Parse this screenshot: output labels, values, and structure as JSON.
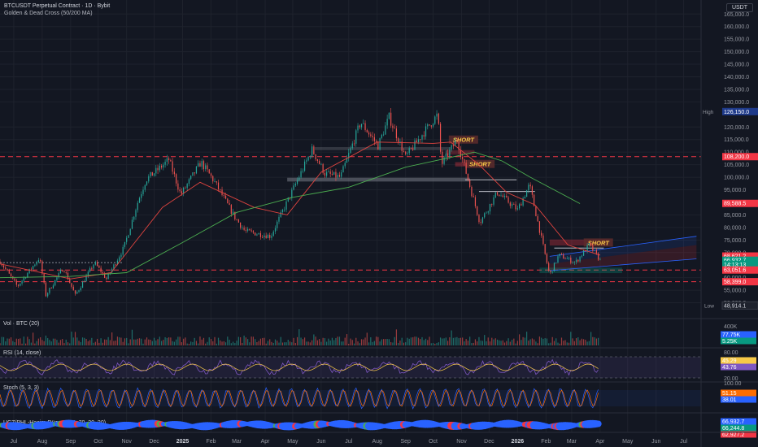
{
  "header": {
    "title": "BTCUSDT Perpetual Contract · 1D · Bybit",
    "indicator": "Golden & Dead Cross (50/200 MA)",
    "currency": "USDT"
  },
  "price_axis": {
    "ticks": [
      "165,000.0",
      "160,000.0",
      "155,000.0",
      "150,000.0",
      "145,000.0",
      "140,000.0",
      "135,000.0",
      "130,000.0",
      "120,000.0",
      "115,000.0",
      "110,000.0",
      "105,000.0",
      "100,000.0",
      "95,000.0",
      "85,000.0",
      "80,000.0",
      "75,000.0",
      "70,000.0",
      "60,000.0",
      "55,000.0",
      "50,000.0"
    ],
    "tick_values": [
      165000,
      160000,
      155000,
      150000,
      145000,
      140000,
      135000,
      130000,
      120000,
      115000,
      110000,
      105000,
      100000,
      95000,
      85000,
      80000,
      75000,
      70000,
      60000,
      55000,
      50000
    ],
    "high_label": "High",
    "high_value": "126,150.0",
    "low_label": "Low",
    "low_value": "48,914.1",
    "badges": [
      {
        "text": "108,200.0",
        "value": 108200,
        "color": "#f23645"
      },
      {
        "text": "89,588.5",
        "value": 89588.5,
        "color": "#f23645"
      },
      {
        "text": "68,621.2",
        "value": 68621.2,
        "color": "#f23645"
      },
      {
        "text": "66,932.7",
        "value": 66932.7,
        "color": "#089981"
      },
      {
        "text": "14:13:13",
        "value": 65300,
        "color": "#089981"
      },
      {
        "text": "63,051.6",
        "value": 63051.6,
        "color": "#f23645"
      },
      {
        "text": "58,399.0",
        "value": 58399,
        "color": "#f23645"
      }
    ]
  },
  "time_axis": [
    "Jul",
    "Aug",
    "Sep",
    "Oct",
    "Nov",
    "Dec",
    "2025",
    "Feb",
    "Mar",
    "Apr",
    "May",
    "Jun",
    "Jul",
    "Aug",
    "Sep",
    "Oct",
    "Nov",
    "Dec",
    "2026",
    "Feb",
    "Mar",
    "Apr",
    "May",
    "Jun",
    "Jul"
  ],
  "annotations": [
    "SHORT",
    "SHORT",
    "SHORT"
  ],
  "panes": {
    "volume": {
      "title": "Vol · BTC (20)",
      "ticks": [
        "400K"
      ],
      "badges": [
        "77.75K",
        "5.25K"
      ]
    },
    "rsi": {
      "title": "RSI (14, close)",
      "ticks": [
        "80.00",
        "20.00"
      ],
      "badges": [
        "45.29",
        "43.76"
      ]
    },
    "stoch": {
      "title": "Stoch (5, 3, 3)",
      "ticks": [
        "100.00"
      ],
      "badges": [
        "51.15",
        "38.01"
      ]
    },
    "ucz": {
      "title": "UCZ/PHL-Hacim-Düz-v2 (14, 70, 30, 20)",
      "badges": [
        "66,932.7",
        "66,244.8",
        "62,927.2"
      ]
    }
  },
  "chart_data": {
    "type": "candlestick",
    "symbol": "BTCUSDT",
    "interval": "1D",
    "ylim": [
      45000,
      168000
    ],
    "x_range": [
      "2024-06-16",
      "2026-07-20"
    ],
    "price_path": [
      [
        "2024-06-16",
        66500
      ],
      [
        "2024-07-05",
        56500
      ],
      [
        "2024-07-29",
        68000
      ],
      [
        "2024-08-05",
        53000
      ],
      [
        "2024-08-24",
        64000
      ],
      [
        "2024-09-06",
        53000
      ],
      [
        "2024-09-27",
        66000
      ],
      [
        "2024-10-10",
        59500
      ],
      [
        "2024-10-29",
        72000
      ],
      [
        "2024-11-13",
        90000
      ],
      [
        "2024-11-22",
        99000
      ],
      [
        "2024-12-05",
        103000
      ],
      [
        "2024-12-17",
        107000
      ],
      [
        "2024-12-30",
        93000
      ],
      [
        "2025-01-21",
        106000
      ],
      [
        "2025-02-05",
        98000
      ],
      [
        "2025-02-27",
        84000
      ],
      [
        "2025-03-10",
        78500
      ],
      [
        "2025-04-07",
        76500
      ],
      [
        "2025-05-22",
        111000
      ],
      [
        "2025-06-05",
        101500
      ],
      [
        "2025-06-22",
        100000
      ],
      [
        "2025-07-14",
        122000
      ],
      [
        "2025-08-02",
        112500
      ],
      [
        "2025-08-14",
        124000
      ],
      [
        "2025-09-01",
        108000
      ],
      [
        "2025-09-19",
        117000
      ],
      [
        "2025-10-06",
        125000
      ],
      [
        "2025-10-10",
        105000
      ],
      [
        "2025-10-27",
        115000
      ],
      [
        "2025-11-21",
        82000
      ],
      [
        "2025-12-10",
        94000
      ],
      [
        "2026-01-01",
        87000
      ],
      [
        "2026-01-14",
        97000
      ],
      [
        "2026-02-05",
        61000
      ],
      [
        "2026-02-15",
        69000
      ],
      [
        "2026-03-05",
        66000
      ],
      [
        "2026-03-20",
        73000
      ],
      [
        "2026-04-01",
        66932.7
      ]
    ],
    "ma50": [
      [
        "2024-06-16",
        65500
      ],
      [
        "2024-09-01",
        59500
      ],
      [
        "2024-10-15",
        62000
      ],
      [
        "2024-12-10",
        88000
      ],
      [
        "2025-01-20",
        98000
      ],
      [
        "2025-03-20",
        88000
      ],
      [
        "2025-04-25",
        85000
      ],
      [
        "2025-06-01",
        102000
      ],
      [
        "2025-08-01",
        114000
      ],
      [
        "2025-10-01",
        113500
      ],
      [
        "2025-10-20",
        114000
      ],
      [
        "2025-11-20",
        105000
      ],
      [
        "2025-12-20",
        94000
      ],
      [
        "2026-01-20",
        89000
      ],
      [
        "2026-02-25",
        73000
      ],
      [
        "2026-04-01",
        69000
      ]
    ],
    "ma200": [
      [
        "2024-06-16",
        60000
      ],
      [
        "2024-09-01",
        60500
      ],
      [
        "2024-11-01",
        62000
      ],
      [
        "2025-01-01",
        74000
      ],
      [
        "2025-03-01",
        86000
      ],
      [
        "2025-05-01",
        92000
      ],
      [
        "2025-07-01",
        96000
      ],
      [
        "2025-09-01",
        104000
      ],
      [
        "2025-10-15",
        107500
      ],
      [
        "2025-11-15",
        110000
      ],
      [
        "2025-12-15",
        106500
      ],
      [
        "2026-01-15",
        100000
      ],
      [
        "2026-02-15",
        94000
      ],
      [
        "2026-03-10",
        89500
      ]
    ],
    "horizontal_lines": [
      108200,
      63051.6,
      58399
    ],
    "high": 126150,
    "low": 48914.1,
    "last": 66932.7
  }
}
